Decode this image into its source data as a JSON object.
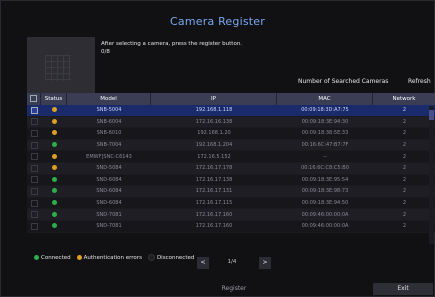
{
  "dialog": {
    "title": "Camera Register",
    "instruction": "After selecting a camera, press the register button.",
    "selected_count": "0/8",
    "searched_label": "Number of Searched Cameras",
    "refresh_label": "Refresh"
  },
  "table": {
    "headers": [
      "",
      "Status",
      "Model",
      "IP",
      "MAC",
      "Network"
    ],
    "rows": [
      {
        "model": "SNB-5004",
        "ip": "192.168.1.118",
        "mac": "00:09:18:3D:A7:75",
        "network": "2",
        "status": "auth"
      },
      {
        "model": "SNB-6004",
        "ip": "172.16.16.138",
        "mac": "00:09:18:3E:94:30",
        "network": "2",
        "status": "auth"
      },
      {
        "model": "SNB-6010",
        "ip": "192.168.1.20",
        "mac": "00:09:18:38:5E:33",
        "network": "2",
        "status": "auth"
      },
      {
        "model": "SNB-7004",
        "ip": "192.168.1.204",
        "mac": "00:16:6C:47:B7:7F",
        "network": "2",
        "status": "connected"
      },
      {
        "model": "EMWF]SNC-C6143",
        "ip": "172.16.5.152",
        "mac": "--",
        "network": "2",
        "status": "auth"
      },
      {
        "model": "SND-5084",
        "ip": "172.16.17.178",
        "mac": "00:16:6C:C8:C5:B0",
        "network": "2",
        "status": "auth"
      },
      {
        "model": "SND-6084",
        "ip": "172.16.17.138",
        "mac": "00:09:18:3E:95:54",
        "network": "2",
        "status": "connected"
      },
      {
        "model": "SND-6084",
        "ip": "172.16.17.131",
        "mac": "00:09:18:3E:98:73",
        "network": "2",
        "status": "connected"
      },
      {
        "model": "SND-6084",
        "ip": "172.16.17.115",
        "mac": "00:09:18:3E:94:50",
        "network": "2",
        "status": "connected"
      },
      {
        "model": "SND-7081",
        "ip": "172.16.17.160",
        "mac": "00:09:46:00:00:0A",
        "network": "2",
        "status": "connected"
      },
      {
        "model": "SND-7081",
        "ip": "172.16.17.160",
        "mac": "00:09:46:00:00:0A",
        "network": "2",
        "status": "connected"
      }
    ]
  },
  "legend": {
    "connected": "Connected",
    "auth_errors": "Authentication errors",
    "disconnected": "Disconnected"
  },
  "pager": {
    "prev": "<",
    "page": "1/4",
    "next": ">"
  },
  "buttons": {
    "register": "Register",
    "exit": "Exit"
  },
  "colors": {
    "title": "#79a8f0",
    "header_bg": "#3b3d55",
    "selected_row": "#1a2b6c",
    "status_connected": "#2db04b",
    "status_auth": "#e0a020",
    "status_disconnected": "#202020"
  }
}
